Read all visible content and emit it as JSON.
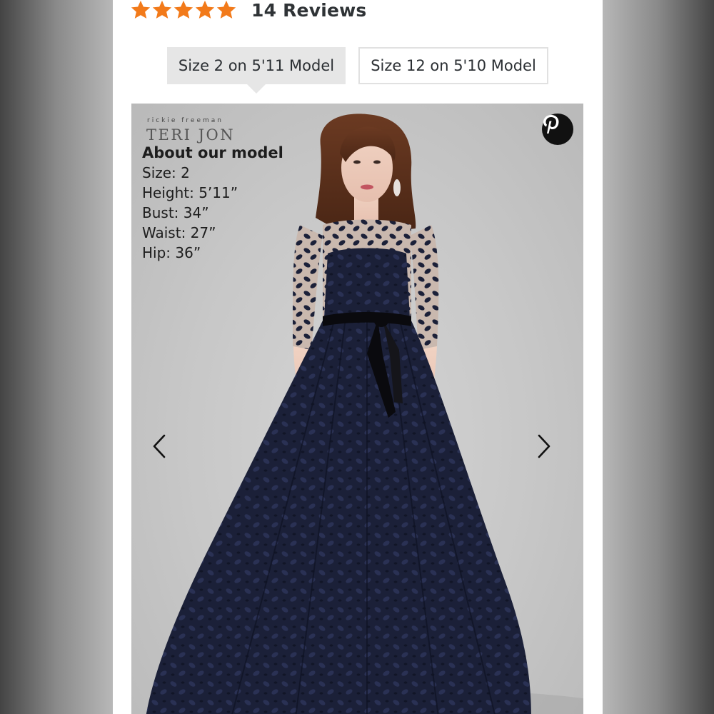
{
  "rating": {
    "stars": 5,
    "star_color": "#f27a1a",
    "reviews_label": "14 Reviews"
  },
  "model_tabs": [
    {
      "label": "Size 2 on 5'11 Model",
      "selected": true
    },
    {
      "label": "Size 12 on 5'10 Model",
      "selected": false
    }
  ],
  "photo": {
    "brand_small": "rickie freeman",
    "brand_large": "TERI JON",
    "model_info_title": "About our model",
    "model_info": [
      "Size: 2",
      "Height: 5’11”",
      "Bust: 34”",
      "Waist: 27”",
      "Hip: 36”"
    ],
    "share_icon": "pinterest-icon",
    "prev_icon": "chevron-left-icon",
    "next_icon": "chevron-right-icon",
    "dress_color": "#1a1f36"
  }
}
